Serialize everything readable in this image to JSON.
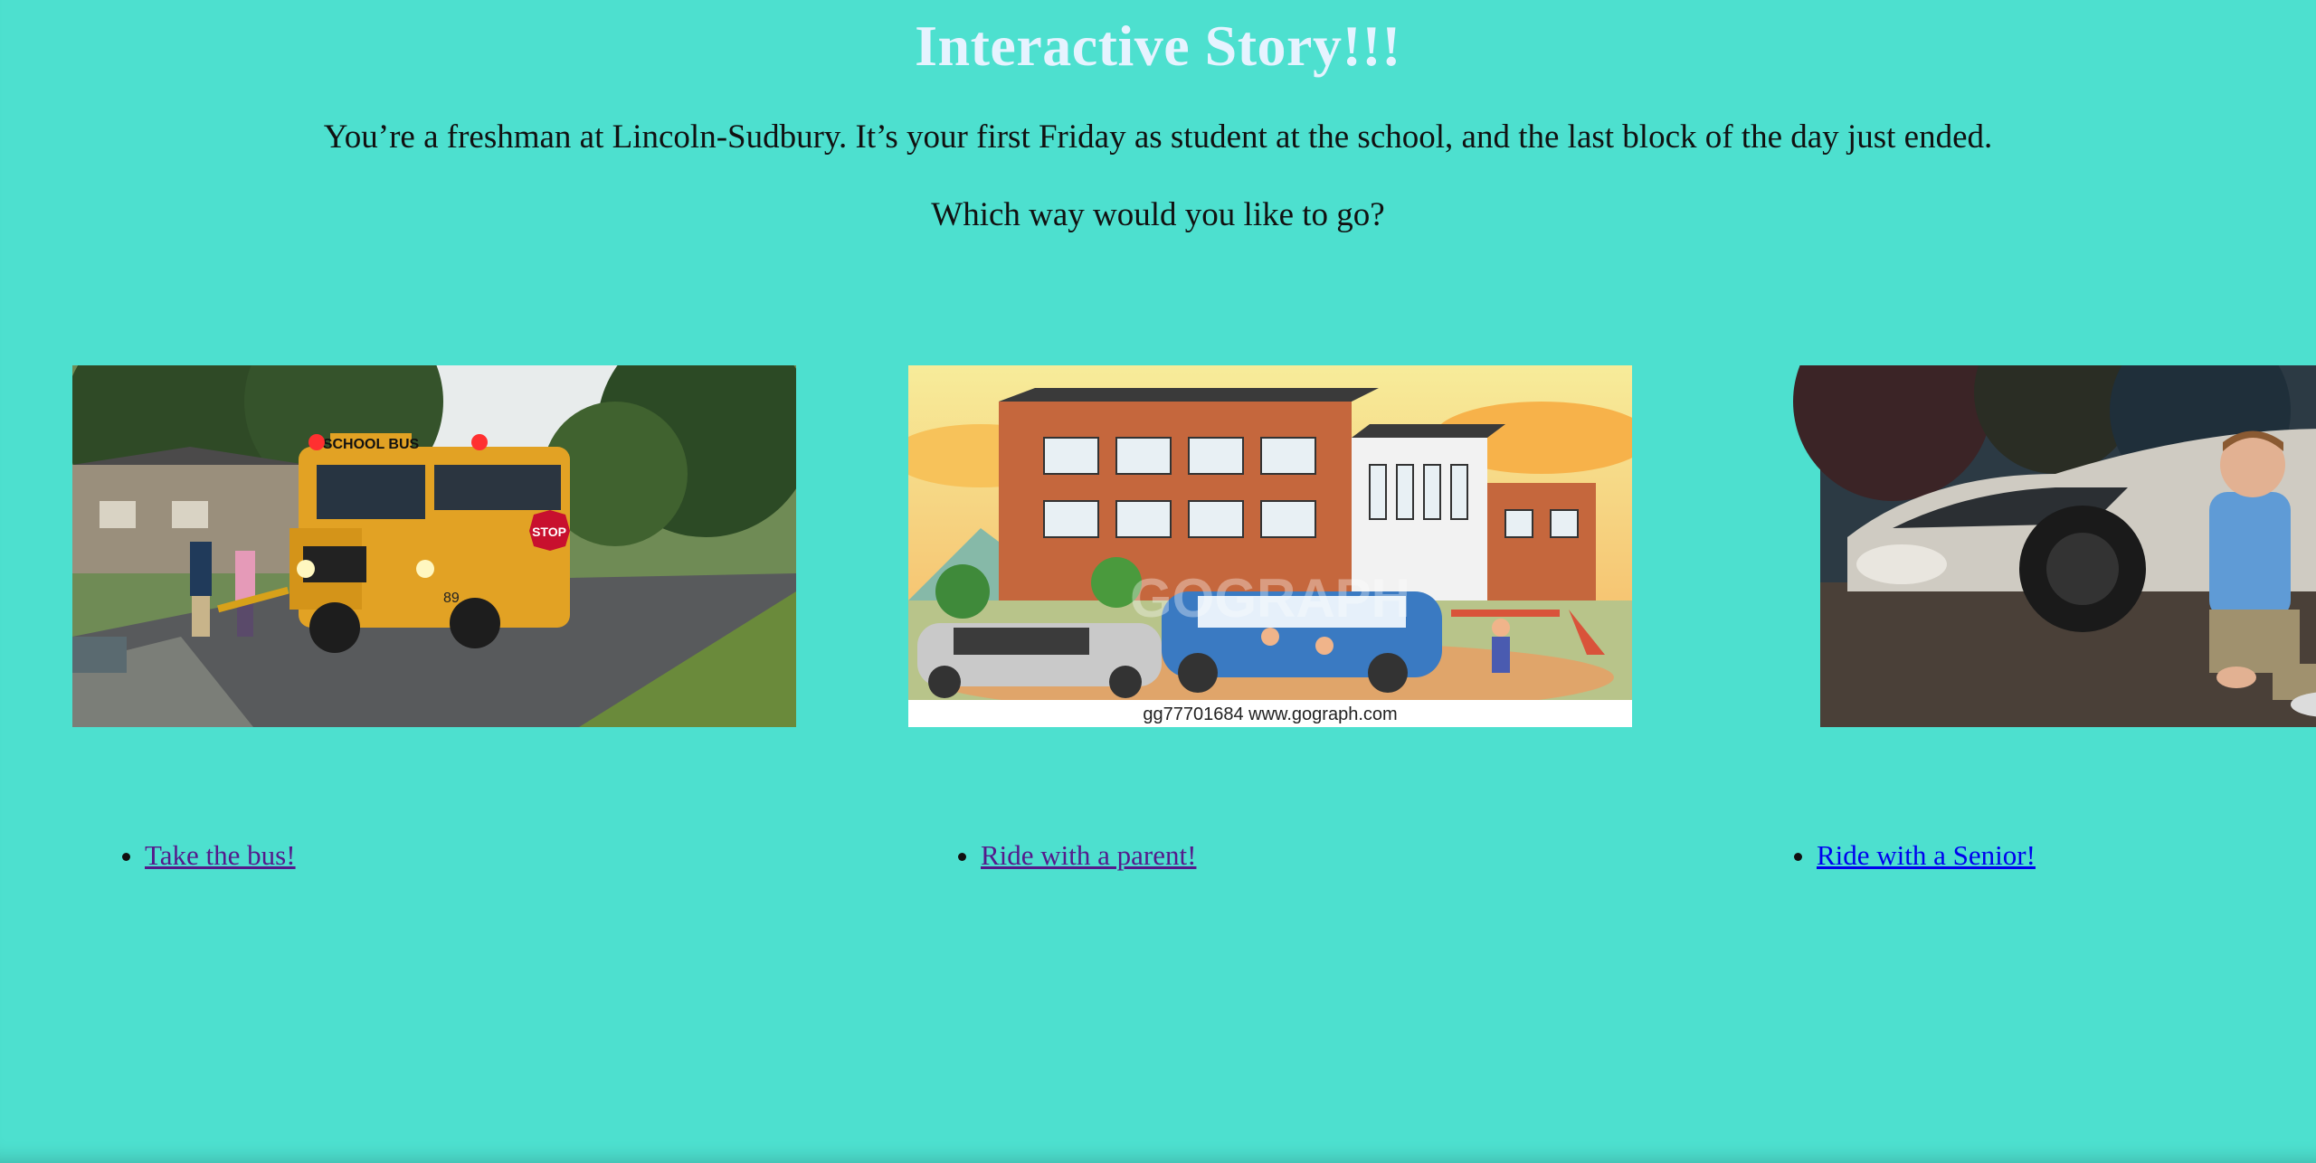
{
  "title": "Interactive Story!!!",
  "intro": "You’re a freshman at Lincoln-Sudbury. It’s your first Friday as student at the school, and the last block of the day just ended.",
  "question": "Which way would you like to go?",
  "colors": {
    "background": "#4de0cf",
    "title": "#e6f3ff",
    "link_visited": "#551a8b",
    "link_unvisited": "#0000ee"
  },
  "choices": [
    {
      "label": "Take the bus!",
      "image": "school-bus-photo",
      "visited": true
    },
    {
      "label": "Ride with a parent!",
      "image": "school-car-pickup-clipart",
      "visited": true
    },
    {
      "label": "Ride with a Senior!",
      "image": "senior-with-car-photo",
      "visited": false
    }
  ],
  "images": {
    "bus_text": "SCHOOL BUS",
    "stop_text": "STOP",
    "bus_number": "89",
    "parent_caption": "gg77701684  www.gograph.com",
    "parent_watermark": "GOGRAPH"
  }
}
